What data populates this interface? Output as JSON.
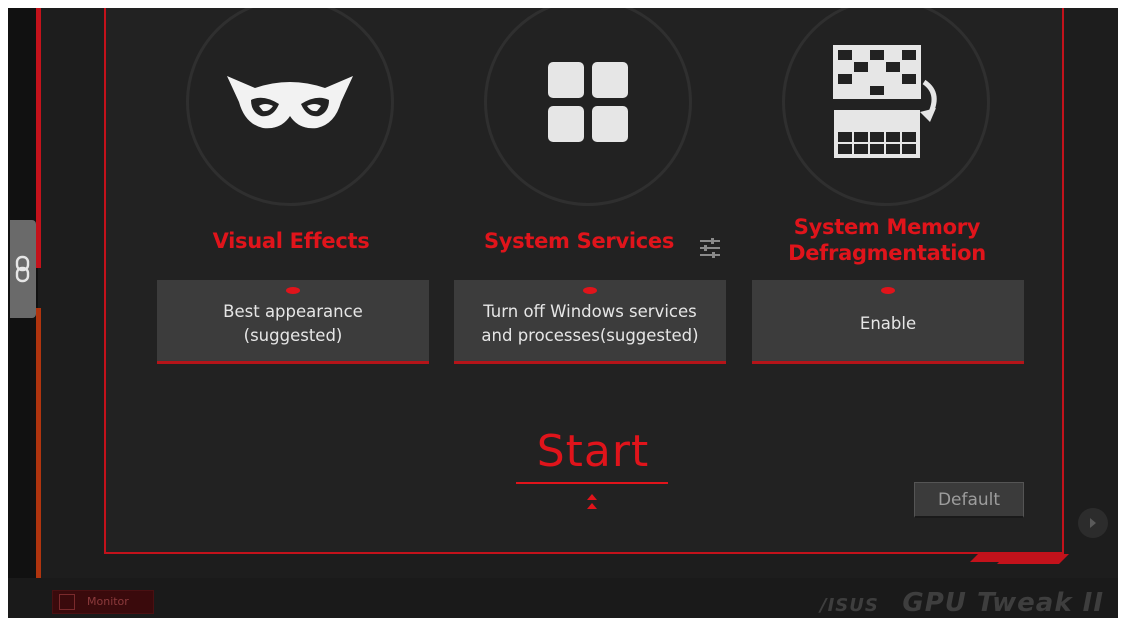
{
  "features": [
    {
      "title": "Visual Effects",
      "option": "Best appearance\n(suggested)"
    },
    {
      "title": "System Services",
      "option": "Turn off Windows services\nand processes(suggested)"
    },
    {
      "title": "System Memory\nDefragmentation",
      "option": "Enable"
    }
  ],
  "actions": {
    "start_label": "Start",
    "default_label": "Default"
  },
  "bottom_bar": {
    "monitor_label": "Monitor",
    "brand_asus": "/ISUS",
    "brand_product": "GPU Tweak II"
  },
  "colors": {
    "accent": "#e0141b",
    "background": "#222222",
    "box": "#3c3c3c"
  },
  "icons": [
    "owl-eyes-icon",
    "windows-tiles-icon",
    "memory-defrag-icon",
    "sliders-icon",
    "link-icon",
    "chevron-right-icon",
    "double-arrow-icon"
  ]
}
